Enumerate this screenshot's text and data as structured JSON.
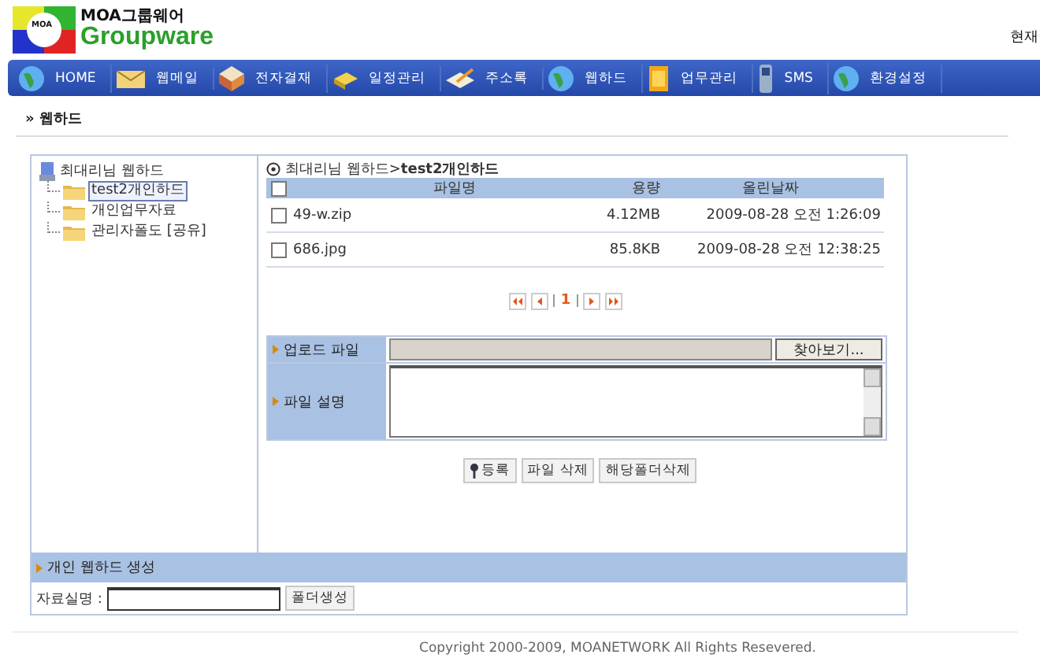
{
  "header": {
    "logo_top": "MOA그룹웨어",
    "logo_bottom": "Groupware",
    "logo_badge": "MOA",
    "date_label": "현재"
  },
  "nav": [
    {
      "label": "HOME"
    },
    {
      "label": "웹메일"
    },
    {
      "label": "전자결재"
    },
    {
      "label": "일정관리"
    },
    {
      "label": "주소록"
    },
    {
      "label": "웹하드"
    },
    {
      "label": "업무관리"
    },
    {
      "label": "SMS"
    },
    {
      "label": "환경설정"
    }
  ],
  "page_title": "» 웹하드",
  "tree": {
    "root": "최대리님 웹하드",
    "children": [
      {
        "label": "test2개인하드",
        "selected": true
      },
      {
        "label": "개인업무자료",
        "selected": false
      },
      {
        "label": "관리자폴도 [공유]",
        "selected": false
      }
    ]
  },
  "path": "최대리님 웹하드>**test2개인하드**",
  "table": {
    "select_all": false,
    "columns": [
      "파일명",
      "용량",
      "올린날짜"
    ],
    "rows": [
      {
        "checked": false,
        "name": "49-w.zip",
        "size": "4.12MB",
        "date": "2009-08-28 오전 1:26:09"
      },
      {
        "checked": false,
        "name": "686.jpg",
        "size": "85.8KB",
        "date": "2009-08-28 오전 12:38:25"
      }
    ]
  },
  "pager": {
    "page": "1"
  },
  "upload": {
    "file_label": "업로드 파일",
    "browse": "찾아보기...",
    "desc_label": "파일 설명"
  },
  "actions": [
    "등록",
    "파일 삭제",
    "해당폴더삭제"
  ],
  "create": {
    "title": "개인 웹하드 생성",
    "field_label": "자료실명 :",
    "button": "폴더생성"
  },
  "footer": "Copyright 2000-2009, MOANETWORK All Rights Resevered."
}
